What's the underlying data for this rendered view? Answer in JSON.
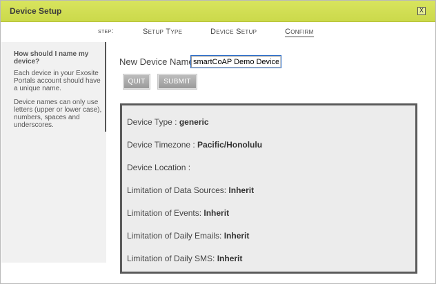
{
  "dialog": {
    "title": "Device Setup",
    "close_label": "X"
  },
  "steps": {
    "label": "step:",
    "items": [
      "Setup Type",
      "Device Setup",
      "Confirm"
    ],
    "active": "Confirm"
  },
  "help": {
    "title": "How should I name my device?",
    "paragraph1": "Each device in your Exosite Portals account should have a unique name.",
    "paragraph2": "Device names can only use letters (upper or lower case), numbers, spaces and underscores."
  },
  "form": {
    "name_label": "New Device Name:",
    "name_value": "smartCoAP Demo Device",
    "quit_label": "QUIT",
    "submit_label": "SUBMIT"
  },
  "summary": {
    "rows": [
      {
        "label": "Device Type : ",
        "value": "generic"
      },
      {
        "label": "Device Timezone : ",
        "value": "Pacific/Honolulu"
      },
      {
        "label": "Device Location : ",
        "value": ""
      },
      {
        "label": "Limitation of Data Sources: ",
        "value": "Inherit"
      },
      {
        "label": "Limitation of Events: ",
        "value": "Inherit"
      },
      {
        "label": "Limitation of Daily Emails: ",
        "value": "Inherit"
      },
      {
        "label": "Limitation of Daily SMS: ",
        "value": "Inherit"
      }
    ]
  },
  "colors": {
    "titlebar": "#d4e157",
    "summary_border": "#5a5a5a",
    "button": "#a9a9a9"
  }
}
